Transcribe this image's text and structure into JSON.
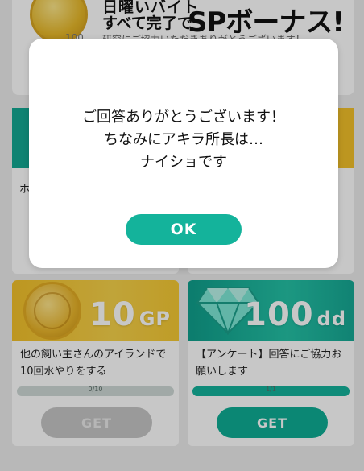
{
  "banner": {
    "coin_amount": "100",
    "title_line1": "日曜いバイト",
    "title_line2": "すべて完了で",
    "title_big": "SPボーナス!",
    "subtitle": "研究にご協力いただきありがとうございます！"
  },
  "middle": {
    "left_partial_text": "ホ"
  },
  "cards": [
    {
      "reward_value": "10",
      "reward_unit": "GP",
      "title": "他の飼い主さんのアイランドで10回水やりをする",
      "progress_label": "0/10",
      "progress_fraction": 0.0,
      "button_label": "GET",
      "button_state": "disabled",
      "icon": "gold-coin-icon"
    },
    {
      "reward_value": "100",
      "reward_unit": "dd",
      "title": "【アンケート】回答にご協力お願いします",
      "progress_label": "1/1",
      "progress_fraction": 1.0,
      "button_label": "GET",
      "button_state": "active",
      "icon": "diamond-icon"
    }
  ],
  "modal": {
    "line1": "ご回答ありがとうございます！",
    "line2": "ちなみにアキラ所長は…",
    "line3": "ナイショです",
    "ok_label": "OK"
  },
  "colors": {
    "accent_teal": "#14b39b",
    "gold": "#f3c12a",
    "disabled_gray": "#c6c6c6"
  }
}
